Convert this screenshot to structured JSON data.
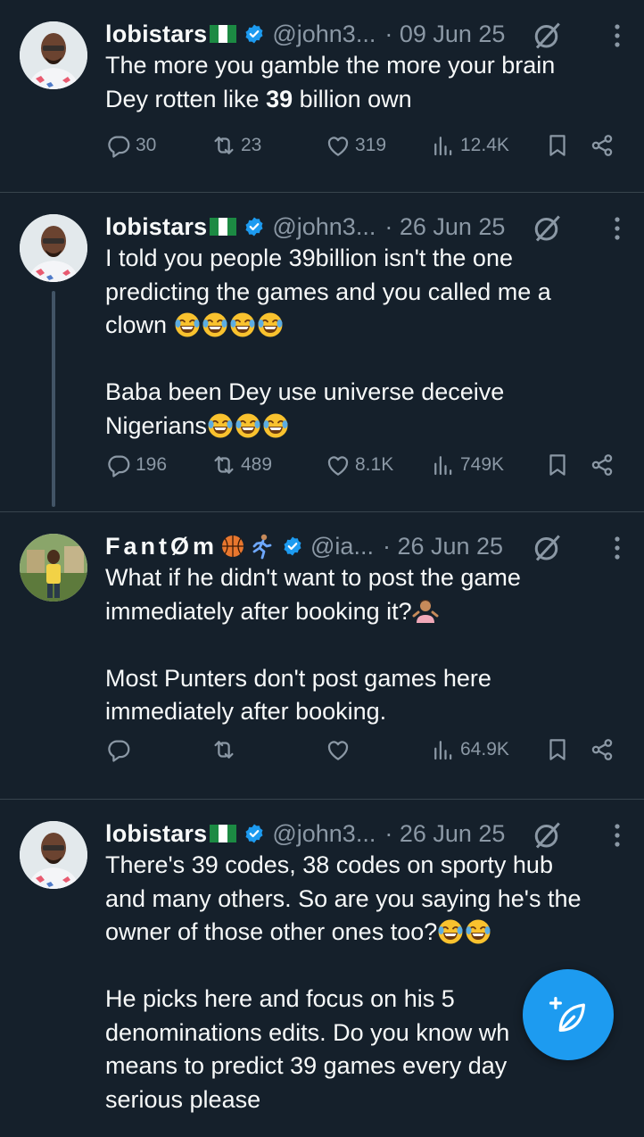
{
  "tweets": [
    {
      "name": "lobistars",
      "handle": "@john3...",
      "date": "· 09 Jun 25",
      "text_parts": [
        "The more you gamble the more your brain\nDey rotten like ",
        "39",
        " billion own"
      ],
      "replies": "30",
      "retweets": "23",
      "likes": "319",
      "views": "12.4K"
    },
    {
      "name": "lobistars",
      "handle": "@john3...",
      "date": "· 26 Jun 25",
      "text_a": "I told you people 39billion isn't the one\npredicting the games and you called me a\nclown ",
      "text_b": "\n\nBaba been Dey use universe deceive\nNigerians",
      "replies": "196",
      "retweets": "489",
      "likes": "8.1K",
      "views": "749K"
    },
    {
      "name": "FantØm",
      "handle": "@ia...",
      "date": "· 26 Jun 25",
      "text_a": "What if he didn't want to post the game\nimmediately after booking it?",
      "text_b": "\n\nMost Punters don't post games here\nimmediately after booking.",
      "replies": "",
      "retweets": "",
      "likes": "",
      "views": "64.9K"
    },
    {
      "name": "lobistars",
      "handle": "@john3...",
      "date": "· 26 Jun 25",
      "text_a": "There's 39 codes, 38 codes on sporty hub\nand many others. So are you saying he's the\nowner of those other ones too?",
      "text_b": "\n\nHe picks here and focus on his 5\ndenominations edits. Do you know wh\nmeans to predict 39 games every day\nserious please"
    }
  ],
  "icons": {
    "reply": "reply-icon",
    "retweet": "retweet-icon",
    "like": "heart-icon",
    "views": "views-icon",
    "bookmark": "bookmark-icon",
    "share": "share-icon",
    "grok": "grok-icon",
    "more": "more-icon",
    "verified": "verified-badge-icon",
    "compose": "compose-post-icon"
  },
  "colors": {
    "background": "#15202b",
    "text": "#f7f9f9",
    "muted": "#8b98a5",
    "accent": "#1d9bf0",
    "divider": "#38444d"
  }
}
